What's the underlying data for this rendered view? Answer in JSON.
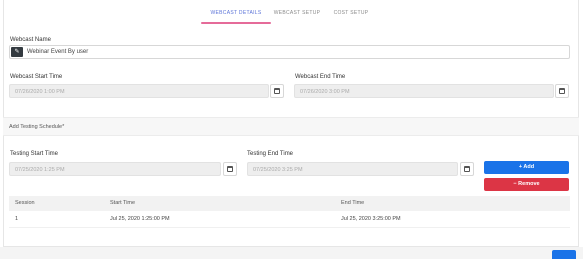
{
  "tabs": [
    {
      "label": "WEBCAST DETAILS",
      "active": true
    },
    {
      "label": "WEBCAST SETUP",
      "active": false
    },
    {
      "label": "COST SETUP",
      "active": false
    }
  ],
  "webcast": {
    "name_label": "Webcast Name",
    "name_value": "Webinar Event By user",
    "name_icon": "pencil-icon",
    "start_label": "Webcast Start Time",
    "start_value": "07/26/2020 1:00 PM",
    "end_label": "Webcast End Time",
    "end_value": "07/26/2020 3:00 PM"
  },
  "testing": {
    "section_title": "Add Testing Schedule*",
    "start_label": "Testing Start Time",
    "start_placeholder": "07/25/2020 1:25 PM",
    "end_label": "Testing End Time",
    "end_placeholder": "07/25/2020 3:25 PM",
    "add_label": "+ Add",
    "remove_label": "− Remove"
  },
  "schedule_table": {
    "columns": [
      "Session",
      "Start Time",
      "End Time"
    ],
    "rows": [
      [
        "1",
        "Jul 25, 2020 1:25:00 PM",
        "Jul 25, 2020 3:25:00 PM"
      ]
    ]
  },
  "colors": {
    "accent": "#5b73d8",
    "tab_underline": "#e56b99",
    "primary": "#1a73e8",
    "danger": "#dc3545"
  }
}
